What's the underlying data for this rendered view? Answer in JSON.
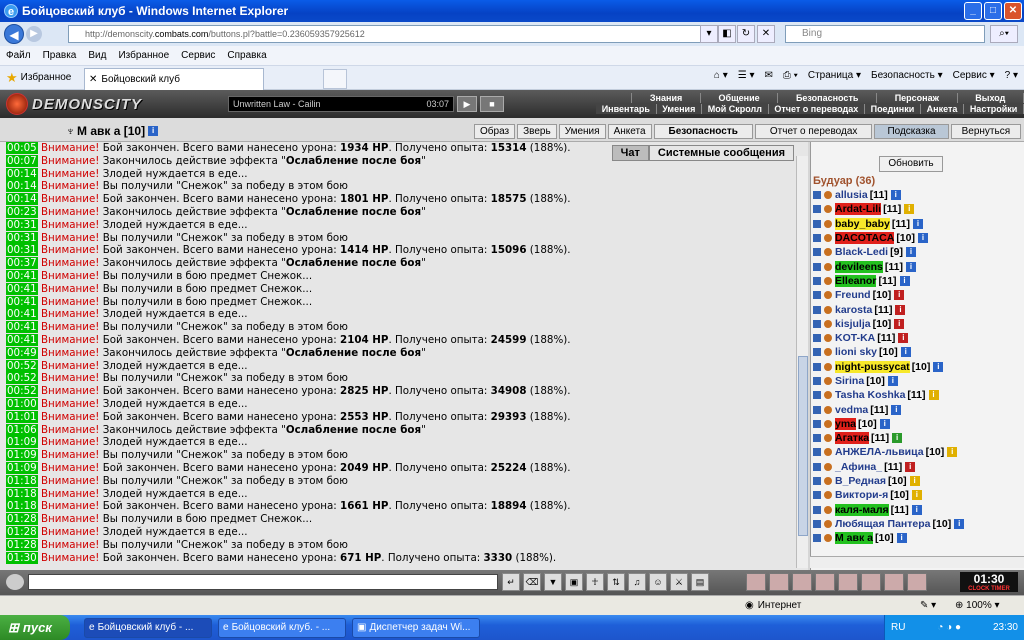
{
  "window": {
    "title": "Бойцовский клуб - Windows Internet Explorer"
  },
  "address": {
    "url_prefix": "http://demonscity.",
    "url_host": "combats.com",
    "url_suffix": "/buttons.pl?battle=0.236059357925612",
    "search_placeholder": "Bing"
  },
  "menu": [
    "Файл",
    "Правка",
    "Вид",
    "Избранное",
    "Сервис",
    "Справка"
  ],
  "favorites": {
    "label": "Избранное",
    "tab_label": "Бойцовский клуб"
  },
  "commands": [
    "Страница ▾",
    "Безопасность ▾",
    "Сервис ▾"
  ],
  "game": {
    "logo": "DEMONSCITY",
    "player_track": "Unwritten Law - Cailin",
    "player_time": "03:07",
    "topnav": [
      "Знания",
      "Общение",
      "Безопасность",
      "Персонаж",
      "Выход"
    ],
    "topnav2": [
      "Инвентарь",
      "Умения",
      "Мой Скролл",
      "Отчет о переводах",
      "Поединки",
      "Анкета",
      "Настройки"
    ],
    "nick": "М авк а [10]",
    "subtabs": [
      "Образ",
      "Зверь",
      "Умения",
      "Анкета",
      "Безопасность",
      "Отчет о переводах",
      "Подсказка",
      "Вернуться"
    ],
    "chat_tabs": [
      "Чат",
      "Системные сообщения"
    ],
    "refresh": "Обновить",
    "room": "Будуар (36)",
    "clock": "01:30",
    "clock_label": "CLOCK   TIMER"
  },
  "chat": [
    {
      "t": "00:05",
      "parts": [
        [
          "warn",
          "Внимание!"
        ],
        [
          "n",
          " Бой закончен. Всего вами нанесено урона: "
        ],
        [
          "b",
          "1934 HP"
        ],
        [
          "n",
          ". Получено опыта: "
        ],
        [
          "b",
          "15314"
        ],
        [
          "n",
          " (188%)."
        ]
      ]
    },
    {
      "t": "00:07",
      "parts": [
        [
          "warn",
          "Внимание!"
        ],
        [
          "n",
          " Закончилось действие эффекта \""
        ],
        [
          "b",
          "Ослабление после боя"
        ],
        [
          "n",
          "\""
        ]
      ]
    },
    {
      "t": "00:14",
      "parts": [
        [
          "warn",
          "Внимание!"
        ],
        [
          "n",
          " Злодей нуждается в еде..."
        ]
      ]
    },
    {
      "t": "00:14",
      "parts": [
        [
          "warn",
          "Внимание!"
        ],
        [
          "n",
          " Вы получили \"Снежок\" за победу в этом бою"
        ]
      ]
    },
    {
      "t": "00:14",
      "parts": [
        [
          "warn",
          "Внимание!"
        ],
        [
          "n",
          " Бой закончен. Всего вами нанесено урона: "
        ],
        [
          "b",
          "1801 HP"
        ],
        [
          "n",
          ". Получено опыта: "
        ],
        [
          "b",
          "18575"
        ],
        [
          "n",
          " (188%)."
        ]
      ]
    },
    {
      "t": "00:23",
      "parts": [
        [
          "warn",
          "Внимание!"
        ],
        [
          "n",
          " Закончилось действие эффекта \""
        ],
        [
          "b",
          "Ослабление после боя"
        ],
        [
          "n",
          "\""
        ]
      ]
    },
    {
      "t": "00:31",
      "parts": [
        [
          "warn",
          "Внимание!"
        ],
        [
          "n",
          " Злодей нуждается в еде..."
        ]
      ]
    },
    {
      "t": "00:31",
      "parts": [
        [
          "warn",
          "Внимание!"
        ],
        [
          "n",
          " Вы получили \"Снежок\" за победу в этом бою"
        ]
      ]
    },
    {
      "t": "00:31",
      "parts": [
        [
          "warn",
          "Внимание!"
        ],
        [
          "n",
          " Бой закончен. Всего вами нанесено урона: "
        ],
        [
          "b",
          "1414 HP"
        ],
        [
          "n",
          ". Получено опыта: "
        ],
        [
          "b",
          "15096"
        ],
        [
          "n",
          " (188%)."
        ]
      ]
    },
    {
      "t": "00:37",
      "parts": [
        [
          "warn",
          "Внимание!"
        ],
        [
          "n",
          " Закончилось действие эффекта \""
        ],
        [
          "b",
          "Ослабление после боя"
        ],
        [
          "n",
          "\""
        ]
      ]
    },
    {
      "t": "00:41",
      "parts": [
        [
          "warn",
          "Внимание!"
        ],
        [
          "n",
          " Вы получили в бою предмет Снежок..."
        ]
      ]
    },
    {
      "t": "00:41",
      "parts": [
        [
          "warn",
          "Внимание!"
        ],
        [
          "n",
          " Вы получили в бою предмет Снежок..."
        ]
      ]
    },
    {
      "t": "00:41",
      "parts": [
        [
          "warn",
          "Внимание!"
        ],
        [
          "n",
          " Вы получили в бою предмет Снежок..."
        ]
      ]
    },
    {
      "t": "00:41",
      "parts": [
        [
          "warn",
          "Внимание!"
        ],
        [
          "n",
          " Злодей нуждается в еде..."
        ]
      ]
    },
    {
      "t": "00:41",
      "parts": [
        [
          "warn",
          "Внимание!"
        ],
        [
          "n",
          " Вы получили \"Снежок\" за победу в этом бою"
        ]
      ]
    },
    {
      "t": "00:41",
      "parts": [
        [
          "warn",
          "Внимание!"
        ],
        [
          "n",
          " Бой закончен. Всего вами нанесено урона: "
        ],
        [
          "b",
          "2104 HP"
        ],
        [
          "n",
          ". Получено опыта: "
        ],
        [
          "b",
          "24599"
        ],
        [
          "n",
          " (188%)."
        ]
      ]
    },
    {
      "t": "00:49",
      "parts": [
        [
          "warn",
          "Внимание!"
        ],
        [
          "n",
          " Закончилось действие эффекта \""
        ],
        [
          "b",
          "Ослабление после боя"
        ],
        [
          "n",
          "\""
        ]
      ]
    },
    {
      "t": "00:52",
      "parts": [
        [
          "warn",
          "Внимание!"
        ],
        [
          "n",
          " Злодей нуждается в еде..."
        ]
      ]
    },
    {
      "t": "00:52",
      "parts": [
        [
          "warn",
          "Внимание!"
        ],
        [
          "n",
          " Вы получили \"Снежок\" за победу в этом бою"
        ]
      ]
    },
    {
      "t": "00:52",
      "parts": [
        [
          "warn",
          "Внимание!"
        ],
        [
          "n",
          " Бой закончен. Всего вами нанесено урона: "
        ],
        [
          "b",
          "2825 HP"
        ],
        [
          "n",
          ". Получено опыта: "
        ],
        [
          "b",
          "34908"
        ],
        [
          "n",
          " (188%)."
        ]
      ]
    },
    {
      "t": "01:00",
      "parts": [
        [
          "warn",
          "Внимание!"
        ],
        [
          "n",
          " Злодей нуждается в еде..."
        ]
      ]
    },
    {
      "t": "01:01",
      "parts": [
        [
          "warn",
          "Внимание!"
        ],
        [
          "n",
          " Бой закончен. Всего вами нанесено урона: "
        ],
        [
          "b",
          "2553 HP"
        ],
        [
          "n",
          ". Получено опыта: "
        ],
        [
          "b",
          "29393"
        ],
        [
          "n",
          " (188%)."
        ]
      ]
    },
    {
      "t": "01:06",
      "parts": [
        [
          "warn",
          "Внимание!"
        ],
        [
          "n",
          " Закончилось действие эффекта \""
        ],
        [
          "b",
          "Ослабление после боя"
        ],
        [
          "n",
          "\""
        ]
      ]
    },
    {
      "t": "01:09",
      "parts": [
        [
          "warn",
          "Внимание!"
        ],
        [
          "n",
          " Злодей нуждается в еде..."
        ]
      ]
    },
    {
      "t": "01:09",
      "parts": [
        [
          "warn",
          "Внимание!"
        ],
        [
          "n",
          " Вы получили \"Снежок\" за победу в этом бою"
        ]
      ]
    },
    {
      "t": "01:09",
      "parts": [
        [
          "warn",
          "Внимание!"
        ],
        [
          "n",
          " Бой закончен. Всего вами нанесено урона: "
        ],
        [
          "b",
          "2049 HP"
        ],
        [
          "n",
          ". Получено опыта: "
        ],
        [
          "b",
          "25224"
        ],
        [
          "n",
          " (188%)."
        ]
      ]
    },
    {
      "t": "01:18",
      "parts": [
        [
          "warn",
          "Внимание!"
        ],
        [
          "n",
          " Вы получили \"Снежок\" за победу в этом бою"
        ]
      ]
    },
    {
      "t": "01:18",
      "parts": [
        [
          "warn",
          "Внимание!"
        ],
        [
          "n",
          " Злодей нуждается в еде..."
        ]
      ]
    },
    {
      "t": "01:18",
      "parts": [
        [
          "warn",
          "Внимание!"
        ],
        [
          "n",
          " Бой закончен. Всего вами нанесено урона: "
        ],
        [
          "b",
          "1661 HP"
        ],
        [
          "n",
          ". Получено опыта: "
        ],
        [
          "b",
          "18894"
        ],
        [
          "n",
          " (188%)."
        ]
      ]
    },
    {
      "t": "01:28",
      "parts": [
        [
          "warn",
          "Внимание!"
        ],
        [
          "n",
          " Вы получили в бою предмет Снежок..."
        ]
      ]
    },
    {
      "t": "01:28",
      "parts": [
        [
          "warn",
          "Внимание!"
        ],
        [
          "n",
          " Злодей нуждается в еде..."
        ]
      ]
    },
    {
      "t": "01:28",
      "parts": [
        [
          "warn",
          "Внимание!"
        ],
        [
          "n",
          " Вы получили \"Снежок\" за победу в этом бою"
        ]
      ]
    },
    {
      "t": "01:30",
      "parts": [
        [
          "warn",
          "Внимание!"
        ],
        [
          "n",
          " Бой закончен. Всего вами нанесено урона: "
        ],
        [
          "b",
          "671 HP"
        ],
        [
          "n",
          ". Получено опыта: "
        ],
        [
          "b",
          "3330"
        ],
        [
          "n",
          " (188%)."
        ]
      ]
    }
  ],
  "users": [
    {
      "name": "allusia",
      "lvl": "[11]",
      "hl": "",
      "b": "i"
    },
    {
      "name": "Ardat-Lili",
      "lvl": "[11]",
      "hl": "rd",
      "b": "y"
    },
    {
      "name": "baby_baby",
      "lvl": "[11]",
      "hl": "yl",
      "b": "i"
    },
    {
      "name": "DACOTACA",
      "lvl": "[10]",
      "hl": "rd",
      "b": "i"
    },
    {
      "name": "Black-Ledi",
      "lvl": "[9]",
      "hl": "",
      "b": "i"
    },
    {
      "name": "devileens",
      "lvl": "[11]",
      "hl": "gr",
      "b": "i"
    },
    {
      "name": "Elleanor",
      "lvl": "[11]",
      "hl": "gr",
      "b": "i"
    },
    {
      "name": "Freund",
      "lvl": "[10]",
      "hl": "",
      "b": "r"
    },
    {
      "name": "karosta",
      "lvl": "[11]",
      "hl": "",
      "b": "r"
    },
    {
      "name": "kisjulja",
      "lvl": "[10]",
      "hl": "",
      "b": "r"
    },
    {
      "name": "KOT-KA",
      "lvl": "[11]",
      "hl": "",
      "b": "r"
    },
    {
      "name": "lioni sky",
      "lvl": "[10]",
      "hl": "",
      "b": "i"
    },
    {
      "name": "night-pussycat",
      "lvl": "[10]",
      "hl": "yl",
      "b": "i"
    },
    {
      "name": "Sirina",
      "lvl": "[10]",
      "hl": "",
      "b": "i"
    },
    {
      "name": "Tasha Koshka",
      "lvl": "[11]",
      "hl": "",
      "b": "y"
    },
    {
      "name": "vedma",
      "lvl": "[11]",
      "hl": "",
      "b": "i"
    },
    {
      "name": "yma",
      "lvl": "[10]",
      "hl": "rd",
      "b": "i"
    },
    {
      "name": "Агатка",
      "lvl": "[11]",
      "hl": "rd",
      "b": "g"
    },
    {
      "name": "АНЖЕЛА-львица",
      "lvl": "[10]",
      "hl": "",
      "b": "y"
    },
    {
      "name": "_Афина_",
      "lvl": "[11]",
      "hl": "",
      "b": "r"
    },
    {
      "name": "В_Редная",
      "lvl": "[10]",
      "hl": "",
      "b": "y"
    },
    {
      "name": "Виктори-я",
      "lvl": "[10]",
      "hl": "",
      "b": "y"
    },
    {
      "name": "каля-маля",
      "lvl": "[11]",
      "hl": "gr",
      "b": "i"
    },
    {
      "name": "Любящая Пантера",
      "lvl": "[10]",
      "hl": "",
      "b": "i"
    },
    {
      "name": "М авк а",
      "lvl": "[10]",
      "hl": "gr",
      "b": "i"
    }
  ],
  "statusbar": {
    "zone": "Интернет",
    "zoom": "100%"
  },
  "taskbar": {
    "start": "пуск",
    "tasks": [
      "Бойцовский клуб - ...",
      "Бойцовский клуб. - ...",
      "Диспетчер задач Wi..."
    ],
    "lang": "RU",
    "time": "23:30"
  }
}
